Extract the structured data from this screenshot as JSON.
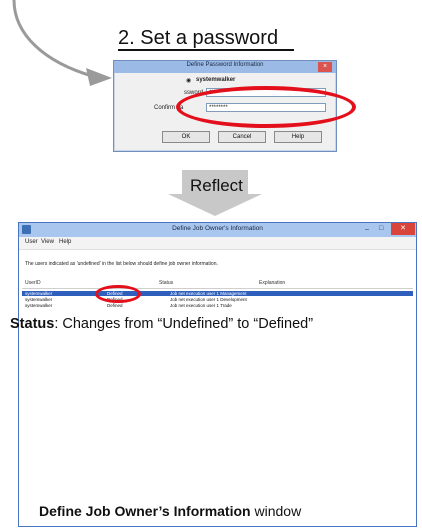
{
  "step": {
    "title": "2. Set a password"
  },
  "dialog": {
    "title": "Define Password Information",
    "close_icon": "×",
    "user_value": "systemwalker",
    "password_label": "ssword",
    "password_value": "********",
    "confirm_label": "Confirm pa",
    "confirm_value": "********",
    "ok_label": "OK",
    "cancel_label": "Cancel",
    "help_label": "Help"
  },
  "reflect": {
    "label": "Reflect"
  },
  "window": {
    "title": "Define Job Owner's Information",
    "menu": [
      "User",
      "View",
      "Help"
    ],
    "note": "The users indicated as 'undefined' in the list below should define job owner information.",
    "columns": [
      "UserID",
      "Status",
      "Explanation"
    ],
    "rows": [
      {
        "user": "systemwalker",
        "status": "Defined",
        "explanation": "Job net execution user 1 Management"
      },
      {
        "user": "systemwalker",
        "status": "Defined",
        "explanation": "Job net execution user 1 Development"
      },
      {
        "user": "systemwalker",
        "status": "Defined",
        "explanation": "Job net execution user 1 Trade"
      }
    ],
    "title_icons": {
      "minimize": "–",
      "maximize": "□",
      "close": "✕"
    }
  },
  "captions": {
    "status_bold": "Status",
    "status_text": ": Changes from “Undefined” to “Defined”",
    "window_bold": "Define Job Owner’s Information",
    "window_text": " window"
  },
  "colors": {
    "highlight_red": "#e3101b",
    "selection_blue": "#2f5fbd",
    "title_bar": "#a9c6ef"
  }
}
